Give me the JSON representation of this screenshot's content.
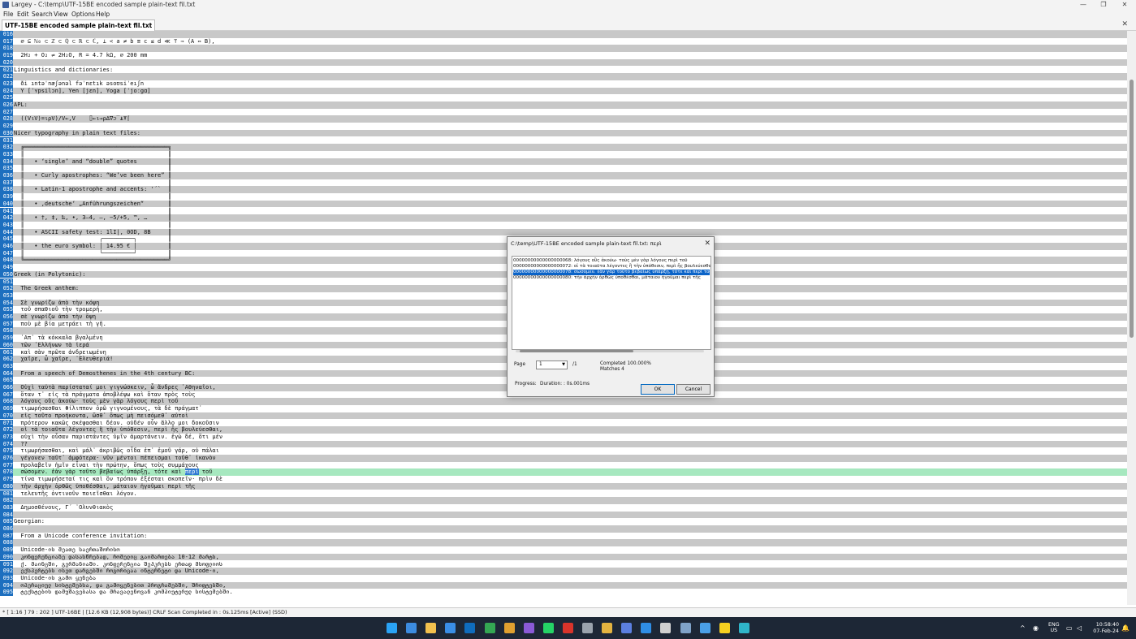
{
  "window": {
    "title": "Largey - C:\\temp\\UTF-15BE encoded sample plain-text fil.txt",
    "min_symbol": "—",
    "max_symbol": "❐",
    "close_symbol": "✕"
  },
  "menu": [
    "File",
    "Edit",
    "Search",
    "View",
    "Options",
    "Help"
  ],
  "tab": {
    "label": "UTF-15BE encoded sample plain-text fil.txt",
    "close_symbol": "✕"
  },
  "lines": [
    {
      "n": "016",
      "t": "",
      "alt": true
    },
    {
      "n": "017",
      "t": "  ∅ ⊆ ℕ₀ ⊂ ℤ ⊂ ℚ ⊂ ℝ ⊂ ℂ, ⊥ < a ≠ b ≡ c ≤ d ≪ ⊤ ⇒ (A ⇔ B),",
      "alt": false
    },
    {
      "n": "018",
      "t": "",
      "alt": true
    },
    {
      "n": "019",
      "t": "  2H₂ + O₂ ⇌ 2H₂O, R = 4.7 kΩ, ⌀ 200 mm",
      "alt": false
    },
    {
      "n": "020",
      "t": "",
      "alt": true
    },
    {
      "n": "021",
      "t": "Linguistics and dictionaries:",
      "alt": false
    },
    {
      "n": "022",
      "t": "",
      "alt": true
    },
    {
      "n": "023",
      "t": "  ði ıntəˈnæʃənəl fəˈnɛtık əsoʊsiˈeıʃn",
      "alt": false
    },
    {
      "n": "024",
      "t": "  Y [ˈʏpsilɔn], Yen [jɛn], Yoga [ˈjoːgɑ]",
      "alt": true
    },
    {
      "n": "025",
      "t": "",
      "alt": false
    },
    {
      "n": "026",
      "t": "APL:",
      "alt": true
    },
    {
      "n": "027",
      "t": "",
      "alt": false
    },
    {
      "n": "028",
      "t": "  ((V⍳V)=⍳⍴V)/V←,V    ⌷←⍳→⍴∆∇⊃‾⍎⍕⌈",
      "alt": true
    },
    {
      "n": "029",
      "t": "",
      "alt": false
    },
    {
      "n": "030",
      "t": "Nicer typography in plain text files:",
      "alt": true
    },
    {
      "n": "031",
      "t": "",
      "alt": false
    },
    {
      "n": "032",
      "t": "  ╔══════════════════════════════════════════╗",
      "alt": true
    },
    {
      "n": "033",
      "t": "  ║                                          ║",
      "alt": false
    },
    {
      "n": "034",
      "t": "  ║   • ‘single’ and “double” quotes         ║",
      "alt": true
    },
    {
      "n": "035",
      "t": "  ║                                          ║",
      "alt": false
    },
    {
      "n": "036",
      "t": "  ║   • Curly apostrophes: “We’ve been here” ║",
      "alt": true
    },
    {
      "n": "037",
      "t": "  ║                                          ║",
      "alt": false
    },
    {
      "n": "038",
      "t": "  ║   • Latin-1 apostrophe and accents: '´`  ║",
      "alt": true
    },
    {
      "n": "039",
      "t": "  ║                                          ║",
      "alt": false
    },
    {
      "n": "040",
      "t": "  ║   • ‚deutsche‘ „Anführungszeichen“       ║",
      "alt": true
    },
    {
      "n": "041",
      "t": "  ║                                          ║",
      "alt": false
    },
    {
      "n": "042",
      "t": "  ║   • †, ‡, ‰, •, 3–4, —, −5/+5, ™, …      ║",
      "alt": true
    },
    {
      "n": "043",
      "t": "  ║                                          ║",
      "alt": false
    },
    {
      "n": "044",
      "t": "  ║   • ASCII safety test: 1lI|, 0OD, 8B     ║",
      "alt": true
    },
    {
      "n": "045",
      "t": "  ║                      ╭─────────╮         ║",
      "alt": false
    },
    {
      "n": "046",
      "t": "  ║   • the euro symbol: │ 14.95 € │         ║",
      "alt": true
    },
    {
      "n": "047",
      "t": "  ║                      ╰─────────╯         ║",
      "alt": false
    },
    {
      "n": "048",
      "t": "  ╚══════════════════════════════════════════╝",
      "alt": true
    },
    {
      "n": "049",
      "t": "",
      "alt": false
    },
    {
      "n": "050",
      "t": "Greek (in Polytonic):",
      "alt": true
    },
    {
      "n": "051",
      "t": "",
      "alt": false
    },
    {
      "n": "052",
      "t": "  The Greek anthem:",
      "alt": true
    },
    {
      "n": "053",
      "t": "",
      "alt": false
    },
    {
      "n": "054",
      "t": "  Σὲ γνωρίζω ἀπὸ τὴν κόψη",
      "alt": true
    },
    {
      "n": "055",
      "t": "  τοῦ σπαθιοῦ τὴν τρομερή,",
      "alt": false
    },
    {
      "n": "056",
      "t": "  σὲ γνωρίζω ἀπὸ τὴν ὄψη",
      "alt": true
    },
    {
      "n": "057",
      "t": "  ποὺ μὲ βία μετράει τὴ γῆ.",
      "alt": false
    },
    {
      "n": "058",
      "t": "",
      "alt": true
    },
    {
      "n": "059",
      "t": "  ᾿Απ᾿ τὰ κόκκαλα βγαλμένη",
      "alt": false
    },
    {
      "n": "060",
      "t": "  τῶν ῾Ελλήνων τὰ ἱερά",
      "alt": true
    },
    {
      "n": "061",
      "t": "  καὶ σὰν πρῶτα ἀνδρειωμένη",
      "alt": false
    },
    {
      "n": "062",
      "t": "  χαῖρε, ὦ χαῖρε, ᾿Ελευθεριά!",
      "alt": true
    },
    {
      "n": "063",
      "t": "",
      "alt": false
    },
    {
      "n": "064",
      "t": "  From a speech of Demosthenes in the 4th century BC:",
      "alt": true
    },
    {
      "n": "065",
      "t": "",
      "alt": false
    },
    {
      "n": "066",
      "t": "  Οὐχὶ ταὐτὰ παρίσταταί μοι γιγνώσκειν, ὦ ἄνδρες ᾿Αθηναῖοι,",
      "alt": true
    },
    {
      "n": "067",
      "t": "  ὅταν τ᾿ εἰς τὰ πράγματα ἀποβλέψω καὶ ὅταν πρὸς τοὺς",
      "alt": false
    },
    {
      "n": "068",
      "t": "  λόγους οὓς ἀκούω· τοὺς μὲν γὰρ λόγους περὶ τοῦ",
      "alt": true
    },
    {
      "n": "069",
      "t": "  τιμωρήσασθαι Φίλιππον ὁρῶ γιγνομένους, τὰ δὲ πράγματ᾿",
      "alt": false
    },
    {
      "n": "070",
      "t": "  εἰς τοῦτο προήκοντα, ὥσθ᾿ ὅπως μὴ πεισόμεθ᾿ αὐτοὶ",
      "alt": true
    },
    {
      "n": "071",
      "t": "  πρότερον κακῶς σκέψασθαι δέον. οὐδέν οὖν ἄλλο μοι δοκοῦσιν",
      "alt": false
    },
    {
      "n": "072",
      "t": "  οἱ τὰ τοιαῦτα λέγοντες ἢ τὴν ὑπόθεσιν, περὶ ἧς βουλεύεσθαι,",
      "alt": true
    },
    {
      "n": "073",
      "t": "  οὐχὶ τὴν οὖσαν παριστάντες ὑμῖν ἁμαρτάνειν. ἐγὼ δέ, ὅτι μέν",
      "alt": false
    },
    {
      "n": "074",
      "t": "  ??",
      "alt": true
    },
    {
      "n": "075",
      "t": "  τιμωρήσασθαι, καὶ μάλ᾿ ἀκριβῶς οἶδα ἐπ᾿ ἐμοῦ γάρ, οὐ πάλαι",
      "alt": false
    },
    {
      "n": "076",
      "t": "  γέγονεν ταῦτ᾿ ἀμφότερα· νῦν μέντοι πέπεισμαι τοῦθ᾿ ἱκανὸν",
      "alt": true
    },
    {
      "n": "077",
      "t": "  προλαβεῖν ἡμῖν εἶναι τὴν πρώτην, ὅπως τοὺς συμμάχους",
      "alt": false
    },
    {
      "n": "078",
      "pre": "  σώσομεν. ἐὰν γὰρ τοῦτο βεβαίως ὑπάρξῃ, τότε καὶ ",
      "m": "περὶ",
      "post": " τοῦ",
      "hl": true
    },
    {
      "n": "079",
      "t": "  τίνα τιμωρήσεταί τις καὶ ὃν τρόπον ἐξέσται σκοπεῖν· πρὶν δὲ",
      "alt": false
    },
    {
      "n": "080",
      "t": "  τὴν ἀρχὴν ὀρθῶς ὑποθέσθαι, μάταιον ἡγοῦμαι περὶ τῆς",
      "alt": true
    },
    {
      "n": "081",
      "t": "  τελευτῆς ὁντινοῦν ποιεῖσθαι λόγον.",
      "alt": false
    },
    {
      "n": "082",
      "t": "",
      "alt": true
    },
    {
      "n": "083",
      "t": "  Δημοσθένους, Γ´ ᾿Ολυνθιακὸς",
      "alt": false
    },
    {
      "n": "084",
      "t": "",
      "alt": true
    },
    {
      "n": "085",
      "t": "Georgian:",
      "alt": false
    },
    {
      "n": "086",
      "t": "",
      "alt": true
    },
    {
      "n": "087",
      "t": "  From a Unicode conference invitation:",
      "alt": false
    },
    {
      "n": "088",
      "t": "",
      "alt": true
    },
    {
      "n": "089",
      "t": "  Unicode-ის მეათე საერთაშორისო",
      "alt": false
    },
    {
      "n": "090",
      "t": "  კონფერენციაზე დასასწრებად, რომელიც გაიმართება 10-12 მარტს,",
      "alt": true
    },
    {
      "n": "091",
      "t": "  ქ. მაინცში, გერმანიაში. კონფერენცია შეჰკრებს ერთად მსოფლიოს",
      "alt": false
    },
    {
      "n": "092",
      "t": "  ექსპერტებს ისეთ დარგებში როგორიცაა ინტერნეტი და Unicode-ი,",
      "alt": true
    },
    {
      "n": "093",
      "t": "  Unicode-ის გამო ყენება",
      "alt": false
    },
    {
      "n": "094",
      "t": "  ოპერაციულ სისტემებსა, და გამოყენებით პროგრამებში, შრიფტებში,",
      "alt": true
    },
    {
      "n": "095",
      "t": "  ტექსტების დამუშავებასა და მრავალენოვან კომპიუტერულ სისტემებში.",
      "alt": false
    }
  ],
  "status": "* [ 1:16 ] 79 : 202 ] UTF-16BE | [12.6 KB (12,908 bytes)] CRLF Scan Completed in : 0s.125ms [Active] (SSD)",
  "dialog": {
    "title": "C:\\temp\\UTF-15BE encoded sample plain-text fil.txt: περὶ",
    "close_symbol": "✕",
    "results": [
      {
        "addr": "00000000000000000068:",
        "text": "λόγους οὓς ἀκούω· τοὺς μὲν γὰρ λόγους περὶ τοῦ",
        "selected": false
      },
      {
        "addr": "00000000000000000072:",
        "text": "οἱ τὰ τοιαῦτα λέγοντες ἢ τὴν ὑπόθεσιν, περὶ ἧς βουλεύεσθαι,",
        "selected": false
      },
      {
        "addr": "00000000000000000078:",
        "text": "σώσομεν. ἐὰν γὰρ τοῦτο βεβαίως ὑπάρξῃ, τότε καὶ περὶ τοῦ",
        "selected": true
      },
      {
        "addr": "00000000000000000080:",
        "text": "τὴν ἀρχὴν ὀρθῶς ὑποθέσθαι, μάταιον ἡγοῦμαι περὶ τῆς",
        "selected": false
      }
    ],
    "page_label": "Page",
    "page_value": "1",
    "page_total": "/1",
    "completed": "Completed 100.000%",
    "matches": "Matches 4",
    "progress_label": "Progress:",
    "duration": "Duration: : 0s.001ms",
    "ok_label": "OK",
    "cancel_label": "Cancel"
  },
  "taskbar": {
    "apps": [
      {
        "name": "start",
        "color": "#2aa3f5"
      },
      {
        "name": "weather",
        "color": "#3c8ce0"
      },
      {
        "name": "explorer",
        "color": "#f2c14e"
      },
      {
        "name": "app4",
        "color": "#3a8ee6"
      },
      {
        "name": "outlook",
        "color": "#0f6cbd"
      },
      {
        "name": "chrome",
        "color": "#34a853"
      },
      {
        "name": "app7",
        "color": "#e0a030"
      },
      {
        "name": "visual-studio",
        "color": "#8a5ad6"
      },
      {
        "name": "whatsapp",
        "color": "#25d366"
      },
      {
        "name": "app10",
        "color": "#d9342b"
      },
      {
        "name": "calculator",
        "color": "#9aa3ad"
      },
      {
        "name": "app12",
        "color": "#e3b340"
      },
      {
        "name": "app13",
        "color": "#5b7fe0"
      },
      {
        "name": "vscode",
        "color": "#2f8ee6"
      },
      {
        "name": "app15",
        "color": "#d0d0d0"
      },
      {
        "name": "app16",
        "color": "#7fa2c8"
      },
      {
        "name": "app17",
        "color": "#4aa0e8"
      },
      {
        "name": "app18",
        "color": "#f5d020"
      },
      {
        "name": "app19",
        "color": "#2fb5c9"
      }
    ],
    "tray_chevron": "^",
    "lang_top": "ENG",
    "lang_bottom": "US",
    "time": "10:58:40",
    "date": "07-Feb-24"
  }
}
